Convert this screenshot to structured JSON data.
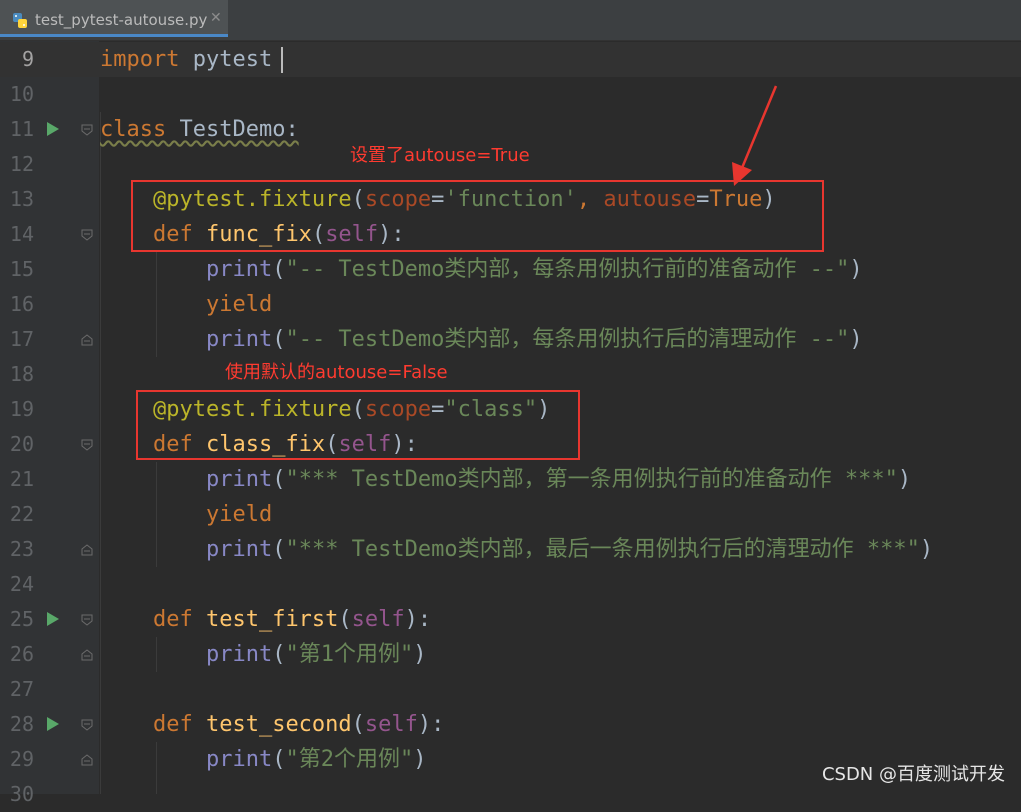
{
  "tab": {
    "filename": "test_pytest-autouse.py",
    "close": "✕",
    "icon": "python-file-icon"
  },
  "annotations": {
    "note1": "设置了autouse=True",
    "note2": "使用默认的autouse=False",
    "color": "#e8362f"
  },
  "watermark": "CSDN @百度测试开发",
  "lines": [
    {
      "n": "9",
      "tokens": [
        [
          "kw",
          "import"
        ],
        [
          "op",
          " pytest"
        ]
      ]
    },
    {
      "n": "10",
      "tokens": []
    },
    {
      "n": "11",
      "tokens": [
        [
          "kw cls",
          "class"
        ],
        [
          "op cls",
          " TestDemo:"
        ]
      ]
    },
    {
      "n": "12",
      "tokens": []
    },
    {
      "n": "13",
      "tokens": [
        [
          "op",
          "    "
        ],
        [
          "dec",
          "@pytest.fixture"
        ],
        [
          "op",
          "("
        ],
        [
          "param",
          "scope"
        ],
        [
          "op",
          "="
        ],
        [
          "str",
          "'function'"
        ],
        [
          "kw",
          ", "
        ],
        [
          "param",
          "autouse"
        ],
        [
          "op",
          "="
        ],
        [
          "kw",
          "True"
        ],
        [
          "op",
          ")"
        ]
      ]
    },
    {
      "n": "14",
      "tokens": [
        [
          "op",
          "    "
        ],
        [
          "kw",
          "def "
        ],
        [
          "fn",
          "func_fix"
        ],
        [
          "op",
          "("
        ],
        [
          "self",
          "self"
        ],
        [
          "op",
          "):"
        ]
      ]
    },
    {
      "n": "15",
      "tokens": [
        [
          "op",
          "        "
        ],
        [
          "bi",
          "print"
        ],
        [
          "op",
          "("
        ],
        [
          "str",
          "\"-- TestDemo类内部，每条用例执行前的准备动作 --\""
        ],
        [
          "op",
          ")"
        ]
      ]
    },
    {
      "n": "16",
      "tokens": [
        [
          "op",
          "        "
        ],
        [
          "kw",
          "yield"
        ]
      ]
    },
    {
      "n": "17",
      "tokens": [
        [
          "op",
          "        "
        ],
        [
          "bi",
          "print"
        ],
        [
          "op",
          "("
        ],
        [
          "str",
          "\"-- TestDemo类内部，每条用例执行后的清理动作 --\""
        ],
        [
          "op",
          ")"
        ]
      ]
    },
    {
      "n": "18",
      "tokens": []
    },
    {
      "n": "19",
      "tokens": [
        [
          "op",
          "    "
        ],
        [
          "dec",
          "@pytest.fixture"
        ],
        [
          "op",
          "("
        ],
        [
          "param",
          "scope"
        ],
        [
          "op",
          "="
        ],
        [
          "str",
          "\"class\""
        ],
        [
          "op",
          ")"
        ]
      ]
    },
    {
      "n": "20",
      "tokens": [
        [
          "op",
          "    "
        ],
        [
          "kw",
          "def "
        ],
        [
          "fn",
          "class_fix"
        ],
        [
          "op",
          "("
        ],
        [
          "self",
          "self"
        ],
        [
          "op",
          "):"
        ]
      ]
    },
    {
      "n": "21",
      "tokens": [
        [
          "op",
          "        "
        ],
        [
          "bi",
          "print"
        ],
        [
          "op",
          "("
        ],
        [
          "str",
          "\"*** TestDemo类内部，第一条用例执行前的准备动作 ***\""
        ],
        [
          "op",
          ")"
        ]
      ]
    },
    {
      "n": "22",
      "tokens": [
        [
          "op",
          "        "
        ],
        [
          "kw",
          "yield"
        ]
      ]
    },
    {
      "n": "23",
      "tokens": [
        [
          "op",
          "        "
        ],
        [
          "bi",
          "print"
        ],
        [
          "op",
          "("
        ],
        [
          "str",
          "\"*** TestDemo类内部，最后一条用例执行后的清理动作 ***\""
        ],
        [
          "op",
          ")"
        ]
      ]
    },
    {
      "n": "24",
      "tokens": []
    },
    {
      "n": "25",
      "tokens": [
        [
          "op",
          "    "
        ],
        [
          "kw",
          "def "
        ],
        [
          "fn",
          "test_first"
        ],
        [
          "op",
          "("
        ],
        [
          "self",
          "self"
        ],
        [
          "op",
          "):"
        ]
      ]
    },
    {
      "n": "26",
      "tokens": [
        [
          "op",
          "        "
        ],
        [
          "bi",
          "print"
        ],
        [
          "op",
          "("
        ],
        [
          "str",
          "\"第1个用例\""
        ],
        [
          "op",
          ")"
        ]
      ]
    },
    {
      "n": "27",
      "tokens": []
    },
    {
      "n": "28",
      "tokens": [
        [
          "op",
          "    "
        ],
        [
          "kw",
          "def "
        ],
        [
          "fn",
          "test_second"
        ],
        [
          "op",
          "("
        ],
        [
          "self",
          "self"
        ],
        [
          "op",
          "):"
        ]
      ]
    },
    {
      "n": "29",
      "tokens": [
        [
          "op",
          "        "
        ],
        [
          "bi",
          "print"
        ],
        [
          "op",
          "("
        ],
        [
          "str",
          "\"第2个用例\""
        ],
        [
          "op",
          ")"
        ]
      ]
    },
    {
      "n": "30",
      "tokens": []
    }
  ]
}
